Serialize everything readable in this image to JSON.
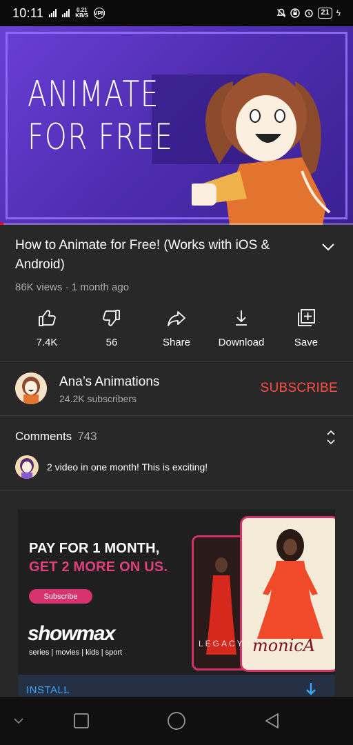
{
  "status_bar": {
    "time": "10:11",
    "net_speed_value": "0.21",
    "net_speed_unit": "KB/S",
    "vpn": "VPN",
    "network_type": "4G",
    "battery": "21",
    "icons": [
      "signal-icon",
      "vpn-icon",
      "mute-icon",
      "lock-icon",
      "alarm-icon",
      "battery-icon",
      "charging-icon"
    ]
  },
  "video": {
    "thumbnail_text": "ANIMATE\nFOR FREE",
    "progress_fraction": 0.01,
    "accent_color": "#ff0000"
  },
  "details": {
    "title": "How to Animate for Free! (Works with iOS & Android)",
    "meta": "86K views · 1 month ago"
  },
  "actions": [
    {
      "label": "7.4K",
      "icon": "like-icon"
    },
    {
      "label": "56",
      "icon": "dislike-icon"
    },
    {
      "label": "Share",
      "icon": "share-icon"
    },
    {
      "label": "Download",
      "icon": "download-icon"
    },
    {
      "label": "Save",
      "icon": "add-to-playlist-icon"
    }
  ],
  "channel": {
    "name": "Ana’s Animations",
    "subscribers": "24.2K subscribers",
    "subscribe_label": "SUBSCRIBE",
    "subscribe_color": "#ff4e45"
  },
  "comments": {
    "title": "Comments",
    "count": "743",
    "top_comment": "2 video in one month! This is exciting!"
  },
  "ad": {
    "headline_1": "PAY FOR 1 MONTH,",
    "headline_2": "GET 2 MORE ON US.",
    "cta": "Subscribe",
    "brand": "showmax",
    "tags": "series | movies | kids | sport",
    "show_1": "LEGACY",
    "show_2": "monicA",
    "install_label": "INSTALL",
    "accent_color": "#e0407a"
  },
  "navbar": {
    "icons": [
      "collapse-icon",
      "recents-icon",
      "home-icon",
      "back-icon"
    ]
  }
}
